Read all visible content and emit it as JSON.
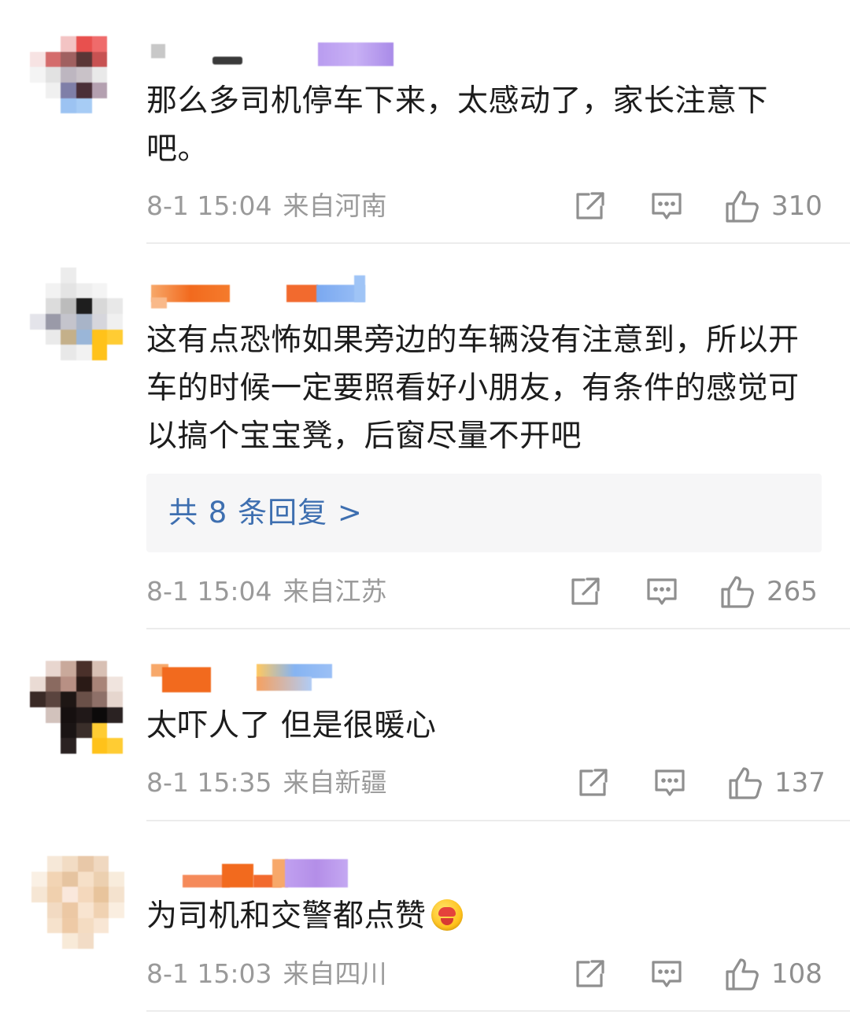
{
  "comments": [
    {
      "text": "那么多司机停车下来，太感动了，家长注意下吧。",
      "time": "8-1 15:04",
      "location": "来自河南",
      "likes": "310"
    },
    {
      "text": "这有点恐怖如果旁边的车辆没有注意到，所以开车的时候一定要照看好小朋友，有条件的感觉可以搞个宝宝凳，后窗尽量不开吧",
      "time": "8-1 15:04",
      "location": "来自江苏",
      "likes": "265",
      "replies_label": "共 8 条回复 >"
    },
    {
      "text": "太吓人了 但是很暖心",
      "time": "8-1 15:35",
      "location": "来自新疆",
      "likes": "137"
    },
    {
      "text": "为司机和交警都点赞",
      "emoji": "heart-eyes-emoji",
      "time": "8-1 15:03",
      "location": "来自四川",
      "likes": "108"
    }
  ],
  "icons": {
    "share": "share-icon",
    "comment": "comment-icon",
    "like": "thumbs-up-icon"
  },
  "colors": {
    "link": "#3e6fb0",
    "meta": "#9a9a9a",
    "replies_bg": "#f6f6f7"
  }
}
